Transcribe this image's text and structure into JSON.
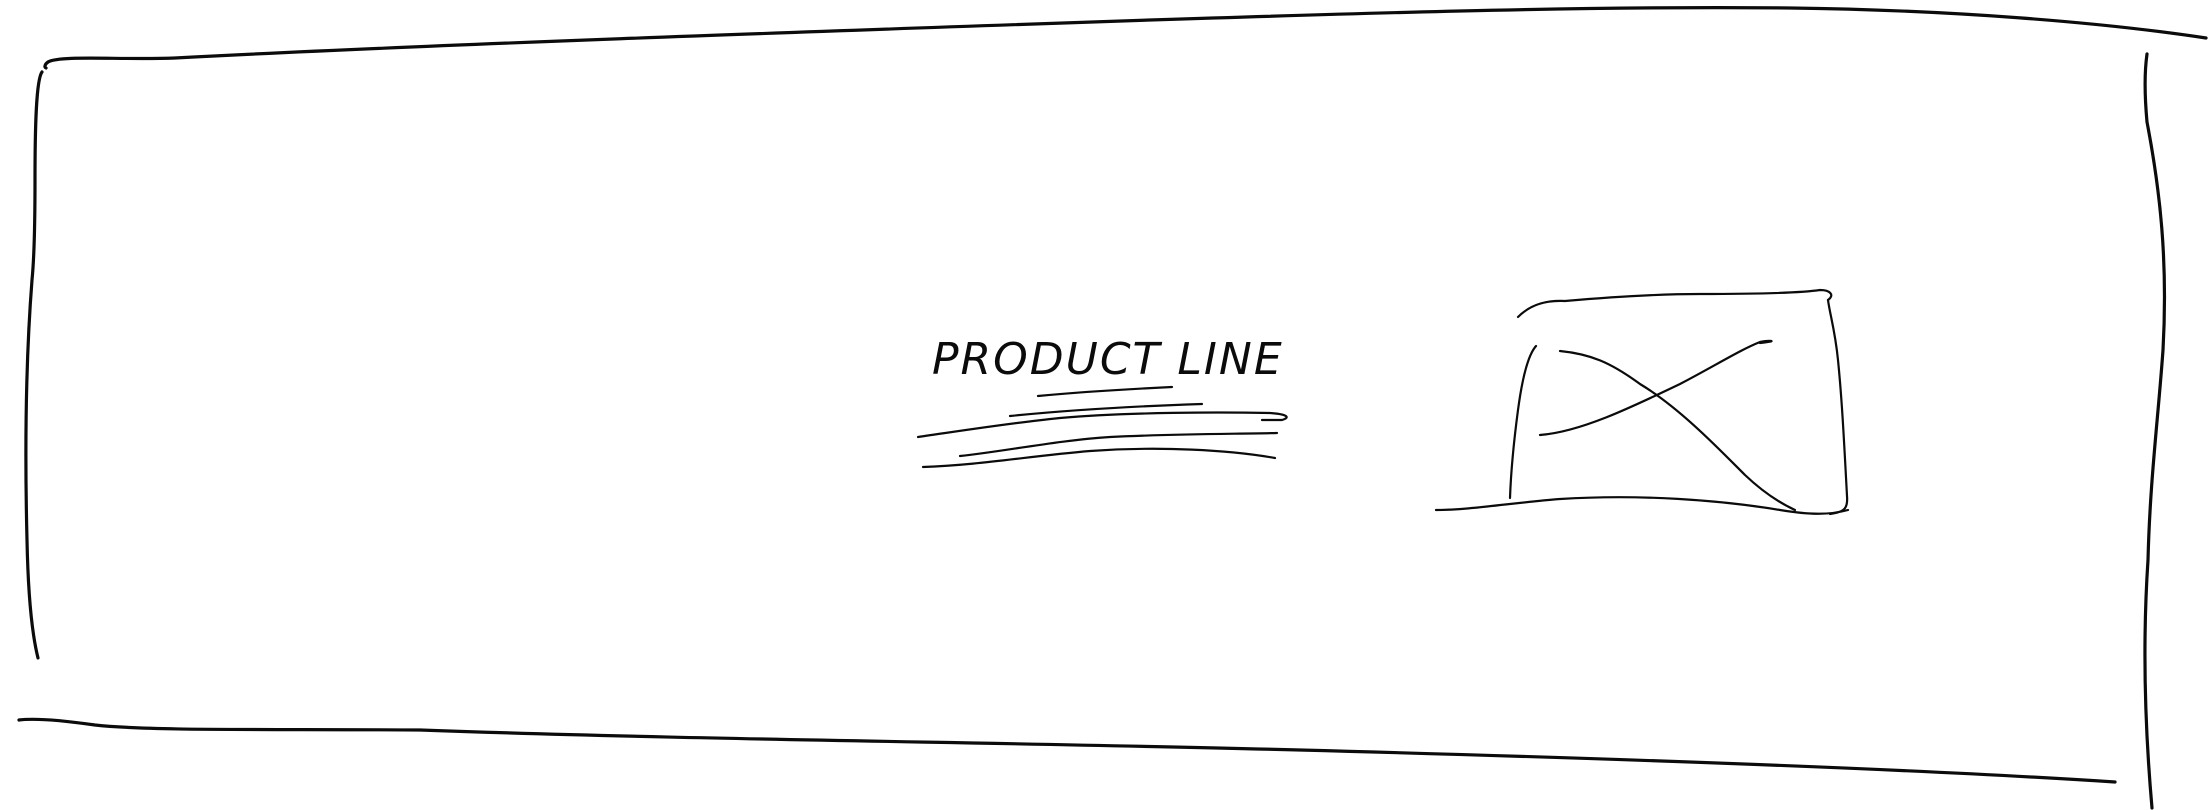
{
  "banner": {
    "heading": "PRODUCT LINE"
  },
  "image_placeholder": {
    "icon": "image-placeholder-icon"
  },
  "colors": {
    "ink": "#0b0b0b",
    "paper": "#ffffff"
  }
}
